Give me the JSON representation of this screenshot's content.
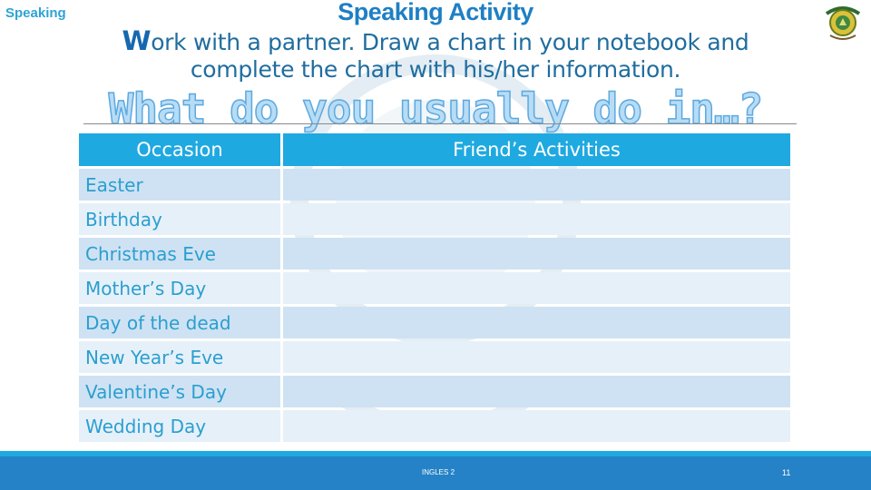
{
  "header": {
    "section_label": "Speaking",
    "title": "Speaking Activity",
    "instructions_first_letter": "W",
    "instructions_line1_rest": "ork with a partner. Draw a chart in your notebook and",
    "instructions_line2": "complete the chart with his/her information.",
    "question": "What do you usually do in…?",
    "logo_icon": "university-crest-icon"
  },
  "table": {
    "headers": [
      "Occasion",
      "Friend’s Activities"
    ],
    "rows": [
      {
        "occasion": "Easter",
        "activities": ""
      },
      {
        "occasion": "Birthday",
        "activities": ""
      },
      {
        "occasion": "Christmas Eve",
        "activities": ""
      },
      {
        "occasion": "Mother’s Day",
        "activities": ""
      },
      {
        "occasion": "Day of the dead",
        "activities": ""
      },
      {
        "occasion": "New Year’s Eve",
        "activities": ""
      },
      {
        "occasion": "Valentine’s Day",
        "activities": ""
      },
      {
        "occasion": "Wedding Day",
        "activities": ""
      }
    ]
  },
  "footer": {
    "course": "INGLES 2",
    "page_number": "11"
  },
  "colors": {
    "header_blue": "#1fa9e1",
    "row_dark": "#cfe2f3",
    "row_light": "#e6f0f9",
    "footer_blue": "#2682c6",
    "text_blue": "#2a9fd0"
  }
}
